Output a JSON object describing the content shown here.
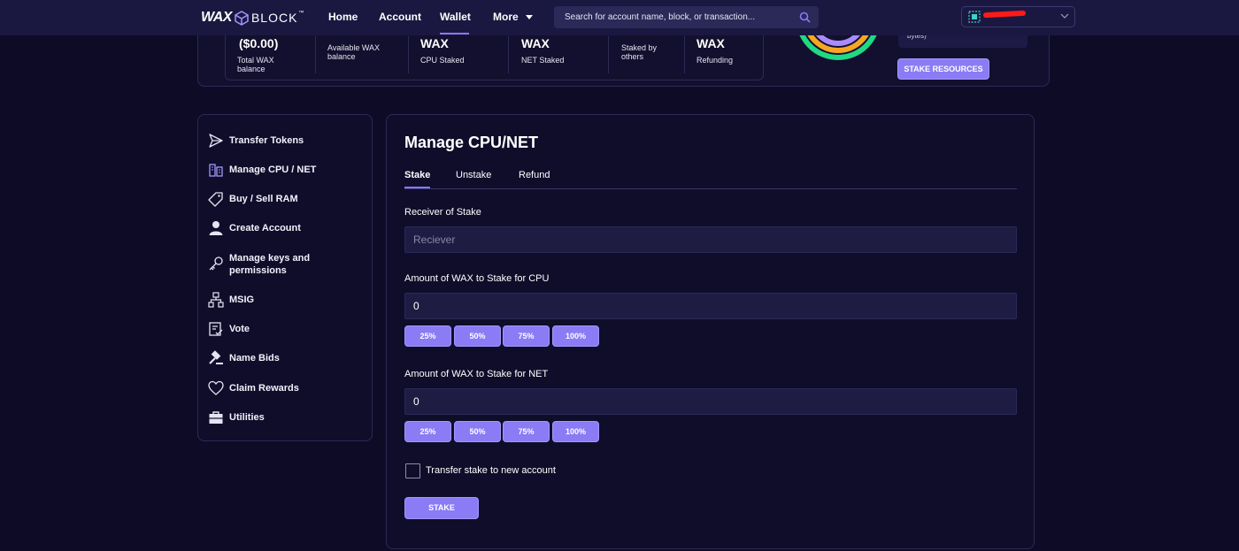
{
  "nav": {
    "logo_wax": "WAX",
    "logo_block": "BLOCK",
    "logo_tm": "™",
    "items": [
      {
        "label": "Home"
      },
      {
        "label": "Account"
      },
      {
        "label": "Wallet"
      },
      {
        "label": "More"
      }
    ],
    "search_placeholder": "Search for account name, block, or transaction...",
    "accent": "#8a78ff"
  },
  "summary": {
    "stats": [
      {
        "value": "($0.00)",
        "label": "Total WAX balance"
      },
      {
        "value": "",
        "label": "Available WAX balance"
      },
      {
        "value": "WAX",
        "label": "CPU Staked"
      },
      {
        "value": "WAX",
        "label": "NET Staked"
      },
      {
        "value": "",
        "label": "Staked by others"
      },
      {
        "value": "WAX",
        "label": "Refunding"
      }
    ],
    "resource_note": "bytes)",
    "stake_resources_button": "STAKE RESOURCES",
    "gauge_colors": [
      "#20d985",
      "#f5a623",
      "#a98bff"
    ]
  },
  "sidebar": {
    "items": [
      {
        "label": "Transfer Tokens"
      },
      {
        "label": "Manage CPU / NET"
      },
      {
        "label": "Buy / Sell RAM"
      },
      {
        "label": "Create Account"
      },
      {
        "label": "Manage keys and permissions"
      },
      {
        "label": "MSIG"
      },
      {
        "label": "Vote"
      },
      {
        "label": "Name Bids"
      },
      {
        "label": "Claim Rewards"
      },
      {
        "label": "Utilities"
      }
    ]
  },
  "main": {
    "title": "Manage CPU/NET",
    "tabs": [
      {
        "label": "Stake"
      },
      {
        "label": "Unstake"
      },
      {
        "label": "Refund"
      }
    ],
    "receiver": {
      "label": "Receiver of Stake",
      "placeholder": "Reciever",
      "value": ""
    },
    "cpu": {
      "label": "Amount of WAX to Stake for CPU",
      "value": "0"
    },
    "net": {
      "label": "Amount of WAX to Stake for NET",
      "value": "0"
    },
    "percent_buttons": [
      "25%",
      "50%",
      "75%",
      "100%"
    ],
    "transfer_label": "Transfer stake to new account",
    "stake_button": "STAKE"
  }
}
